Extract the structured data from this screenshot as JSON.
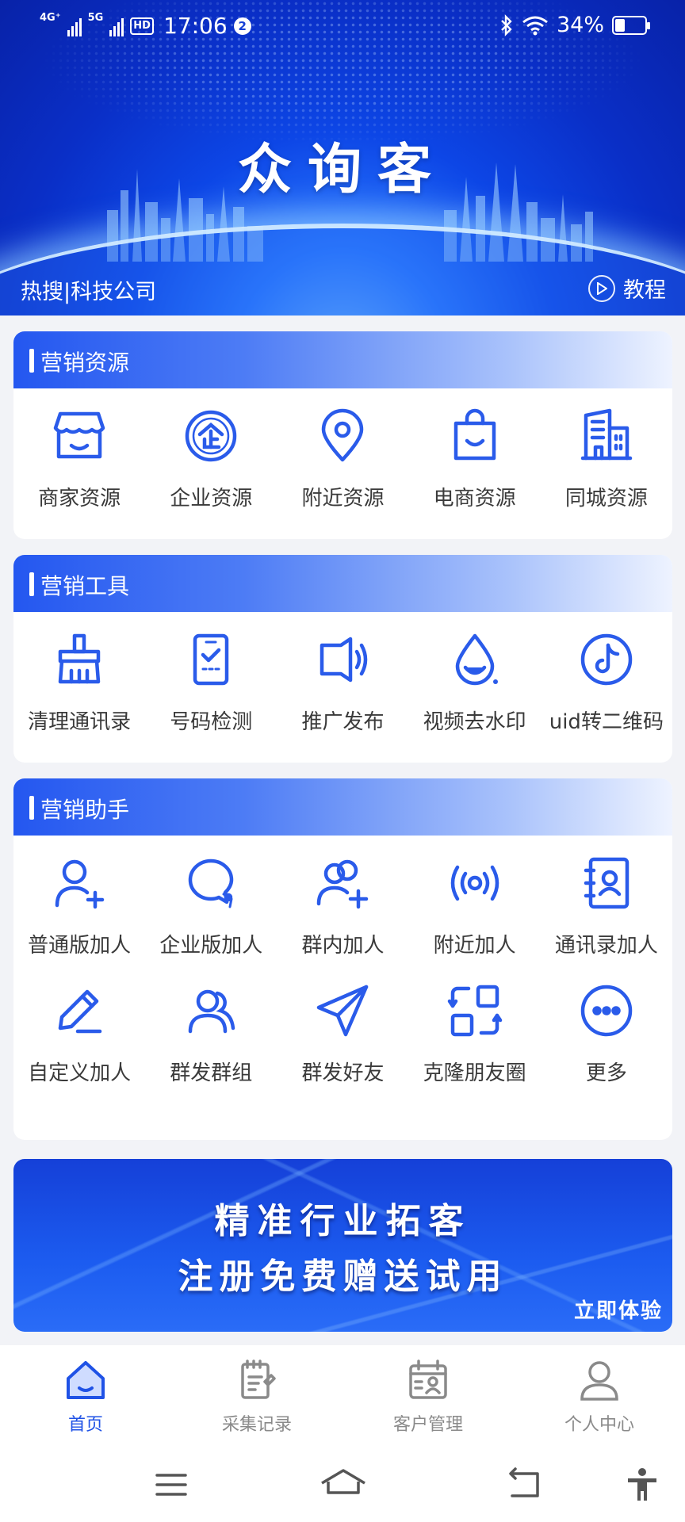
{
  "status_bar": {
    "network_1": "4G⁺",
    "network_2": "5G",
    "hd": "HD",
    "time": "17:06",
    "notification_count": "2",
    "battery": "34%",
    "battery_level": 0.34
  },
  "header": {
    "app_title": "众询客",
    "hot_search": "热搜|科技公司",
    "tutorial_label": "教程"
  },
  "sections": [
    {
      "title": "营销资源",
      "items": [
        {
          "label": "商家资源",
          "icon": "store-icon"
        },
        {
          "label": "企业资源",
          "icon": "enterprise-icon"
        },
        {
          "label": "附近资源",
          "icon": "location-pin-icon"
        },
        {
          "label": "电商资源",
          "icon": "shopping-bag-icon"
        },
        {
          "label": "同城资源",
          "icon": "building-icon"
        }
      ]
    },
    {
      "title": "营销工具",
      "items": [
        {
          "label": "清理通讯录",
          "icon": "brush-icon"
        },
        {
          "label": "号码检测",
          "icon": "phone-check-icon"
        },
        {
          "label": "推广发布",
          "icon": "speaker-icon"
        },
        {
          "label": "视频去水印",
          "icon": "water-drop-icon"
        },
        {
          "label": "uid转二维码",
          "icon": "tiktok-icon"
        }
      ]
    },
    {
      "title": "营销助手",
      "items": [
        {
          "label": "普通版加人",
          "icon": "user-add-icon"
        },
        {
          "label": "企业版加人",
          "icon": "chat-bubble-icon"
        },
        {
          "label": "群内加人",
          "icon": "group-add-icon"
        },
        {
          "label": "附近加人",
          "icon": "radar-icon"
        },
        {
          "label": "通讯录加人",
          "icon": "contact-book-icon"
        },
        {
          "label": "自定义加人",
          "icon": "pencil-icon"
        },
        {
          "label": "群发群组",
          "icon": "group-icon"
        },
        {
          "label": "群发好友",
          "icon": "paper-plane-icon"
        },
        {
          "label": "克隆朋友圈",
          "icon": "clone-icon"
        },
        {
          "label": "更多",
          "icon": "more-icon"
        }
      ]
    }
  ],
  "banner": {
    "line1": "精准行业拓客",
    "line2": "注册免费赠送试用",
    "cta": "立即体验"
  },
  "bottom_nav": [
    {
      "label": "首页",
      "icon": "home-icon",
      "active": true
    },
    {
      "label": "采集记录",
      "icon": "clipboard-icon",
      "active": false
    },
    {
      "label": "客户管理",
      "icon": "calendar-contact-icon",
      "active": false
    },
    {
      "label": "个人中心",
      "icon": "person-icon",
      "active": false
    }
  ],
  "colors": {
    "accent": "#1f52e6",
    "icon_blue": "#2a5bea",
    "header_blue": "#0d46e6",
    "inactive_gray": "#8a8a8a"
  }
}
